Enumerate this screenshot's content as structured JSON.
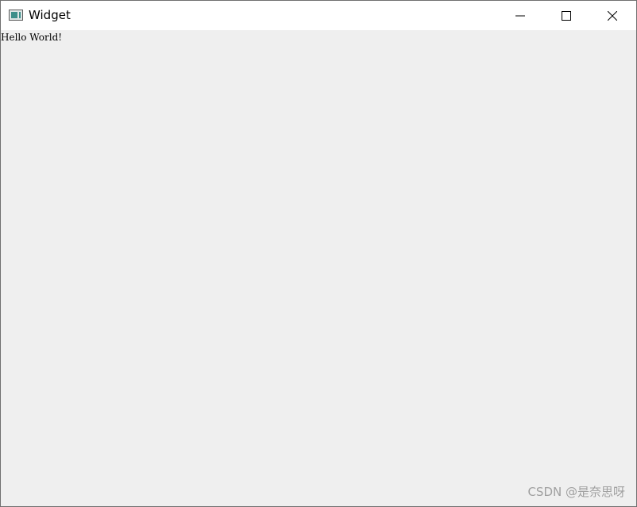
{
  "window": {
    "title": "Widget",
    "icon": "qt-window-icon",
    "controls": {
      "minimize_icon": "minimize-icon",
      "maximize_icon": "maximize-icon",
      "close_icon": "close-icon"
    }
  },
  "content": {
    "label_text": "Hello World!"
  },
  "watermark": {
    "text": "CSDN @是奈思呀"
  }
}
